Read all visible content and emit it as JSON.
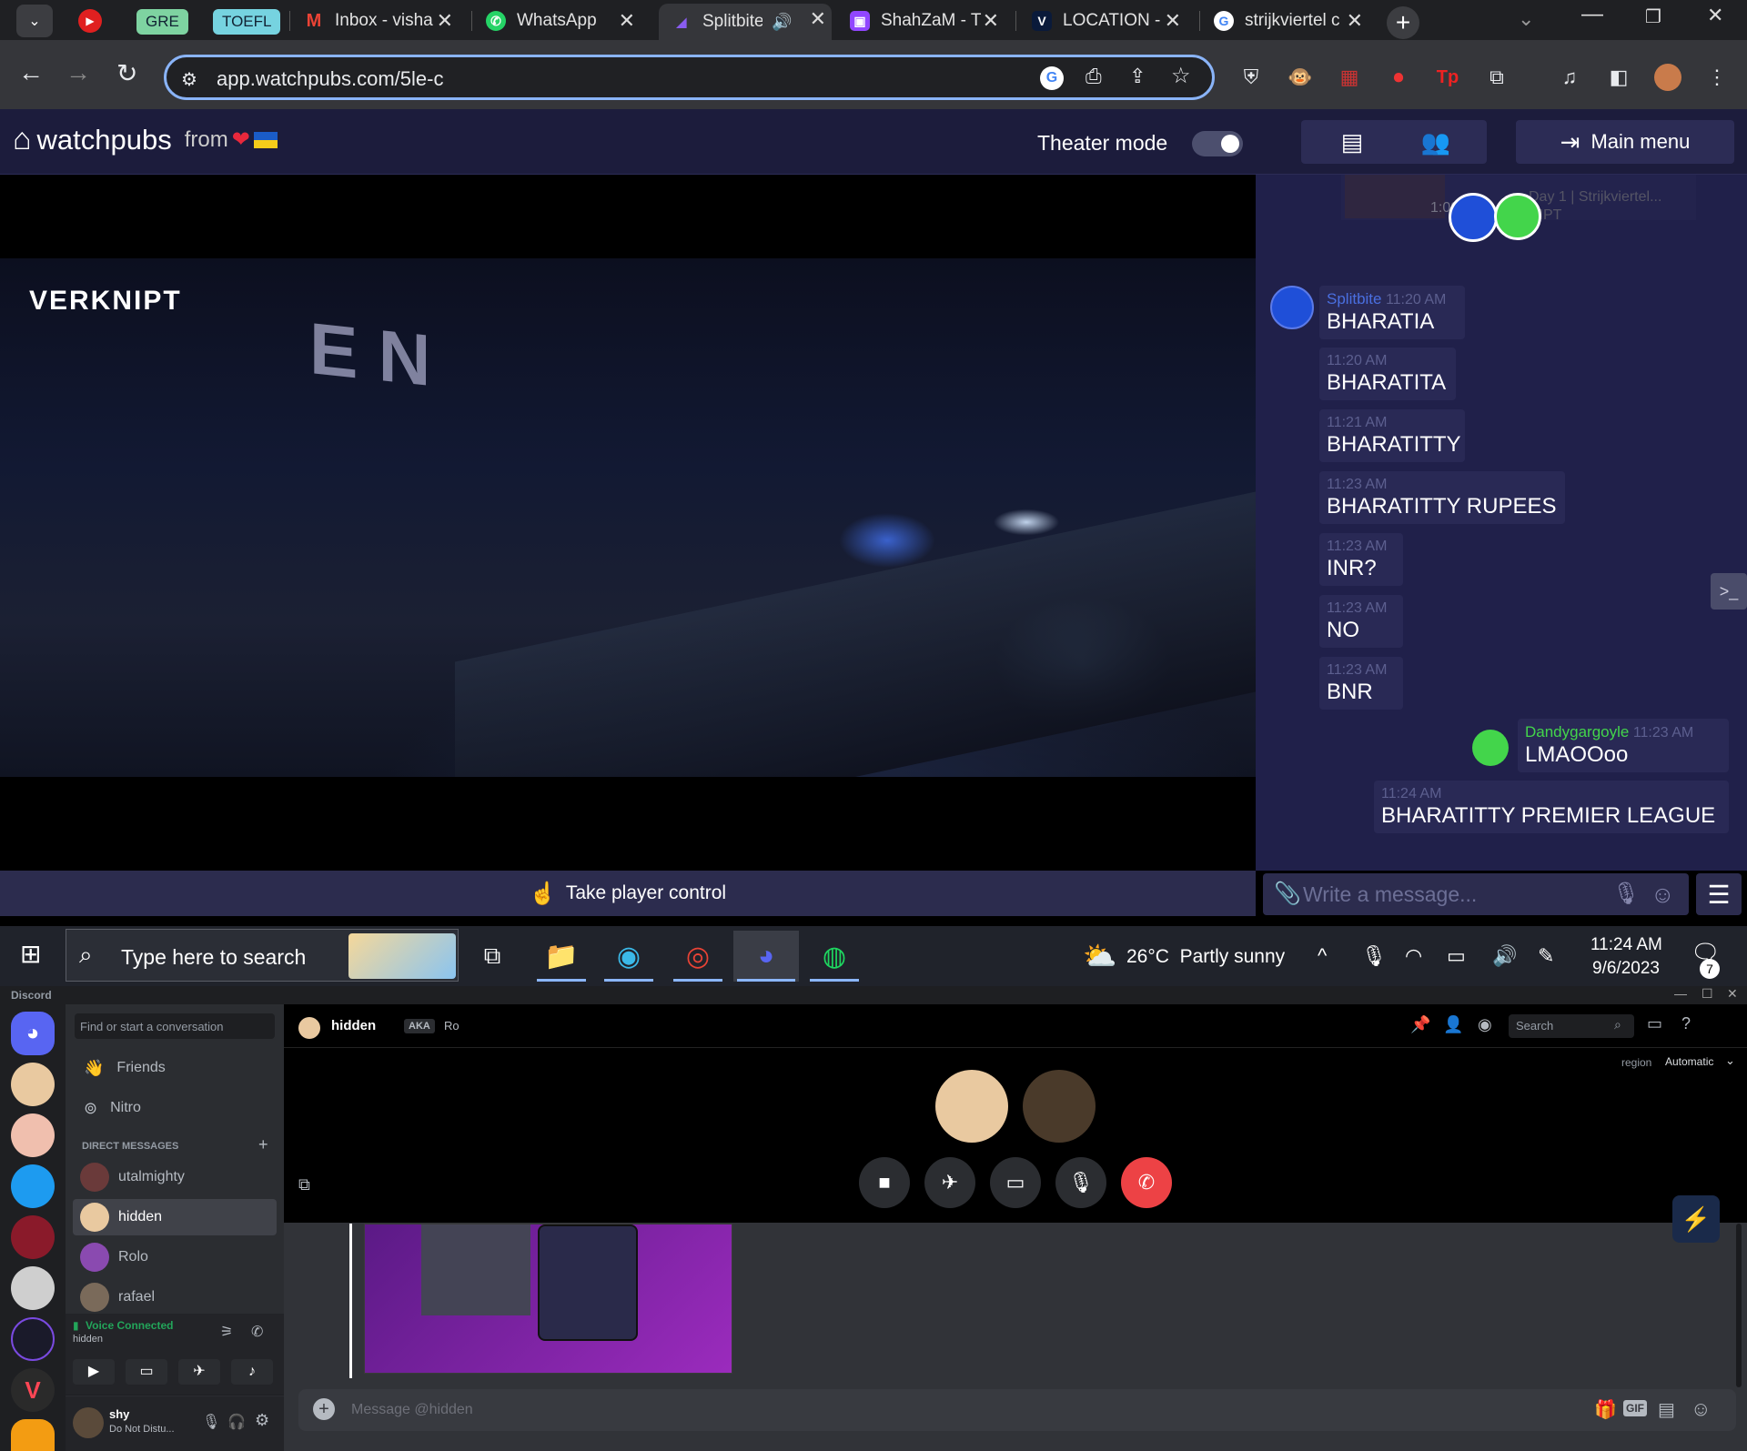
{
  "browser": {
    "tabs": [
      {
        "label": "GRE"
      },
      {
        "label": "TOEFL"
      },
      {
        "label": "Inbox - visha"
      },
      {
        "label": "WhatsApp"
      },
      {
        "label": "Splitbite"
      },
      {
        "label": "ShahZaM - T"
      },
      {
        "label": "LOCATION -"
      },
      {
        "label": "strijkviertel c"
      }
    ],
    "url": "app.watchpubs.com/5le-c"
  },
  "watchpubs": {
    "logo_text": "watchpubs",
    "from_text": "from",
    "theater_mode_label": "Theater mode",
    "theater_mode_on": true,
    "main_menu_label": "Main menu",
    "video_overlay_logo": "VERKNIPT",
    "take_control_label": "Take player control",
    "compose_placeholder": "Write a message...",
    "chat": {
      "preview_timestamp": "1:09:04",
      "preview_title_1": "Day 1 | Strijkviertel...",
      "preview_title_2": "NIPT",
      "messages": [
        {
          "user": "Splitbite",
          "time": "11:20 AM",
          "text": "BHARATIA"
        },
        {
          "time": "11:20 AM",
          "text": "BHARATITA"
        },
        {
          "time": "11:21 AM",
          "text": "BHARATITTY"
        },
        {
          "time": "11:23 AM",
          "text": "BHARATITTY RUPEES"
        },
        {
          "time": "11:23 AM",
          "text": "INR?"
        },
        {
          "time": "11:23 AM",
          "text": "NO"
        },
        {
          "time": "11:23 AM",
          "text": "BNR"
        },
        {
          "user": "Dandygargoyle",
          "time": "11:23 AM",
          "text": "LMAOOoo"
        },
        {
          "time": "11:24 AM",
          "text": "BHARATITTY PREMIER LEAGUE"
        }
      ]
    }
  },
  "taskbar": {
    "search_placeholder": "Type here to search",
    "weather": "26°C  Partly sunny",
    "time": "11:24 AM",
    "date": "9/6/2023",
    "notification_count": "7"
  },
  "discord": {
    "app_label": "Discord",
    "find_placeholder": "Find or start a conversation",
    "friends_label": "Friends",
    "nitro_label": "Nitro",
    "direct_messages_label": "DIRECT MESSAGES",
    "dms": [
      "utalmighty",
      "hidden",
      "Rolo",
      "rafael"
    ],
    "active_dm": "hidden",
    "header_name": "hidden",
    "aka_label": "AKA",
    "aka_value": "Ro",
    "search_placeholder": "Search",
    "region_label": "region",
    "region_value": "Automatic",
    "voice_status": "Voice Connected",
    "voice_channel": "hidden",
    "message_placeholder": "Message @hidden",
    "user_name": "shy",
    "user_status": "Do Not Distu..."
  },
  "colors": {
    "watchpubs_bg": "#20204a",
    "watchpubs_header": "#1c1c3c",
    "accent_green": "#43d54b",
    "splitbite_blue": "#3a52c8",
    "discord_blurple": "#5865f2",
    "end_call_red": "#ed4245"
  }
}
